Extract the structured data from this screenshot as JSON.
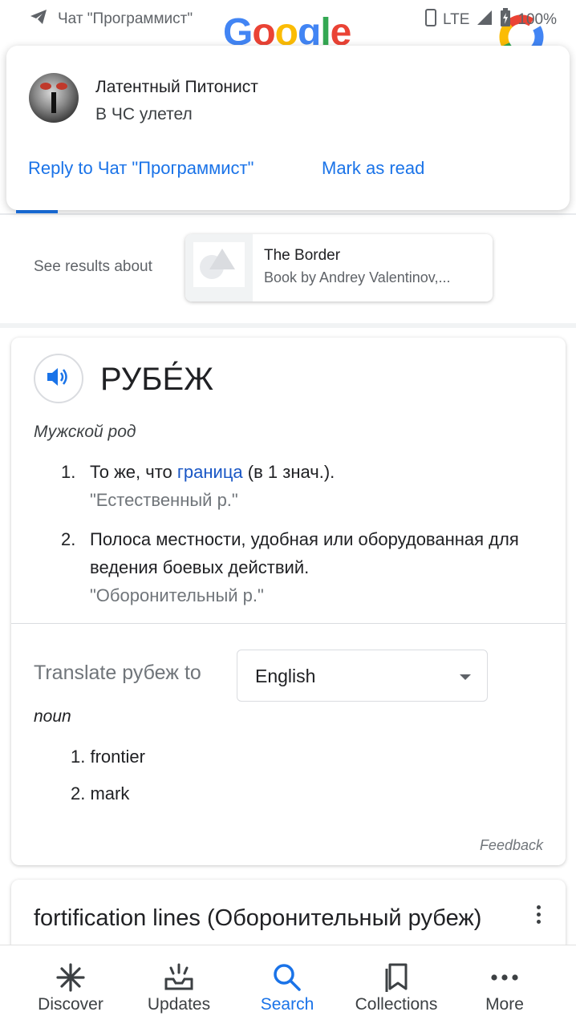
{
  "status_bar": {
    "chat_label": "Чат \"Программист\"",
    "network": "LTE",
    "battery": "100%"
  },
  "google_logo": {
    "g1": "G",
    "o1": "o",
    "o2": "o",
    "g2": "g",
    "l": "l",
    "e": "e"
  },
  "notification": {
    "sender": "Латентный Питонист",
    "message": "В ЧС улетел",
    "reply_action": "Reply to Чат \"Программист\"",
    "mark_read_action": "Mark as read"
  },
  "see_results": {
    "label": "See results about",
    "card_title": "The Border",
    "card_subtitle": "Book by Andrey Valentinov,..."
  },
  "dictionary": {
    "headword": "РУБЕ́Ж",
    "gender": "Мужской род",
    "definitions": [
      {
        "num": "1.",
        "text_before": "То же, что ",
        "link": "граница",
        "text_after": " (в 1 знач.).",
        "example": "\"Естественный р.\""
      },
      {
        "num": "2.",
        "text": "Полоса местности, удобная или оборудованная для ведения боевых действий.",
        "example": "\"Оборонительный р.\""
      }
    ],
    "translate_label": "Translate рубеж to",
    "translate_language": "English",
    "part_of_speech": "noun",
    "translations": [
      "1. frontier",
      "2. mark"
    ],
    "feedback": "Feedback"
  },
  "next_card": {
    "title": "fortification lines (Оборонительный рубеж)"
  },
  "bottom_nav": {
    "items": [
      {
        "label": "Discover",
        "icon": "asterisk-icon"
      },
      {
        "label": "Updates",
        "icon": "updates-tray-icon"
      },
      {
        "label": "Search",
        "icon": "search-icon"
      },
      {
        "label": "Collections",
        "icon": "collections-bookmark-icon"
      },
      {
        "label": "More",
        "icon": "more-dots-icon"
      }
    ],
    "active": "Search"
  },
  "colors": {
    "accent_blue": "#1a73e8",
    "link_blue": "#1a57c5",
    "text_secondary": "#70757a"
  }
}
